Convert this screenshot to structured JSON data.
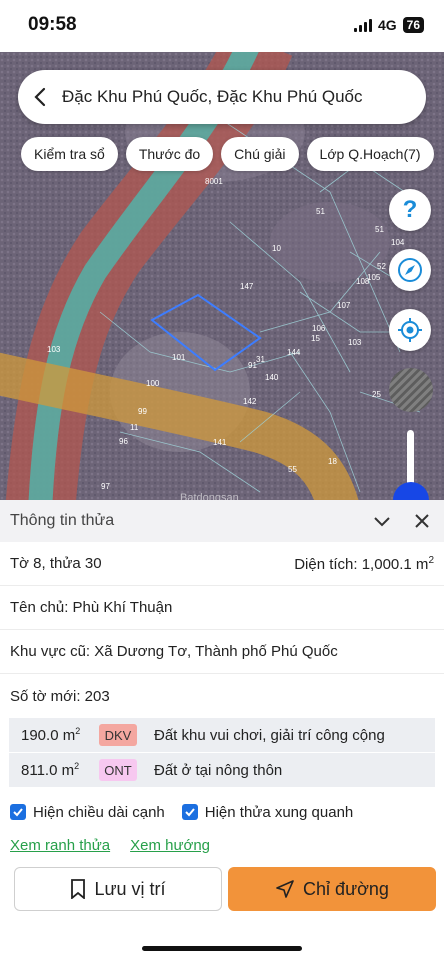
{
  "status_bar": {
    "time": "09:58",
    "network": "4G",
    "battery": "76"
  },
  "search": {
    "text": "Đặc Khu Phú Quốc, Đặc Khu Phú Quốc"
  },
  "chips": [
    "Kiểm tra sổ",
    "Thước đo",
    "Chú giải",
    "Lớp Q.Hoạch(7)"
  ],
  "map": {
    "help_symbol": "?",
    "watermark": "Batdongsan",
    "parcel_labels": [
      "8001",
      "51",
      "51",
      "10",
      "104",
      "52",
      "105",
      "103",
      "147",
      "107",
      "108",
      "106",
      "15",
      "103",
      "144",
      "101",
      "31",
      "140",
      "91",
      "100",
      "25",
      "142",
      "99",
      "11",
      "96",
      "141",
      "55",
      "18",
      "97"
    ]
  },
  "panel": {
    "title": "Thông tin thửa",
    "sheet_plot": "Tờ 8, thửa 30",
    "area_label": "Diện tích: 1,000.1 m",
    "area_sup": "2",
    "owner": "Tên chủ: Phù Khí Thuận",
    "old_area": "Khu vực cũ: Xã Dương Tơ, Thành phố Phú Quốc",
    "new_sheet": "Số tờ mới: 203",
    "usage": [
      {
        "area": "190.0 m",
        "sup": "2",
        "code": "DKV",
        "desc": "Đất khu vui chơi, giải trí công cộng"
      },
      {
        "area": "811.0 m",
        "sup": "2",
        "code": "ONT",
        "desc": "Đất ở tại nông thôn"
      }
    ],
    "check_show_edges": "Hiện chiều dài cạnh",
    "check_show_neighbors": "Hiện thửa xung quanh",
    "link_boundary": "Xem ranh thửa",
    "link_direction": "Xem hướng",
    "btn_save": "Lưu vị trí",
    "btn_directions": "Chỉ đường"
  },
  "colors": {
    "accent_orange": "#f2933a",
    "link_green": "#27a04a",
    "check_blue": "#1b6fe0"
  }
}
